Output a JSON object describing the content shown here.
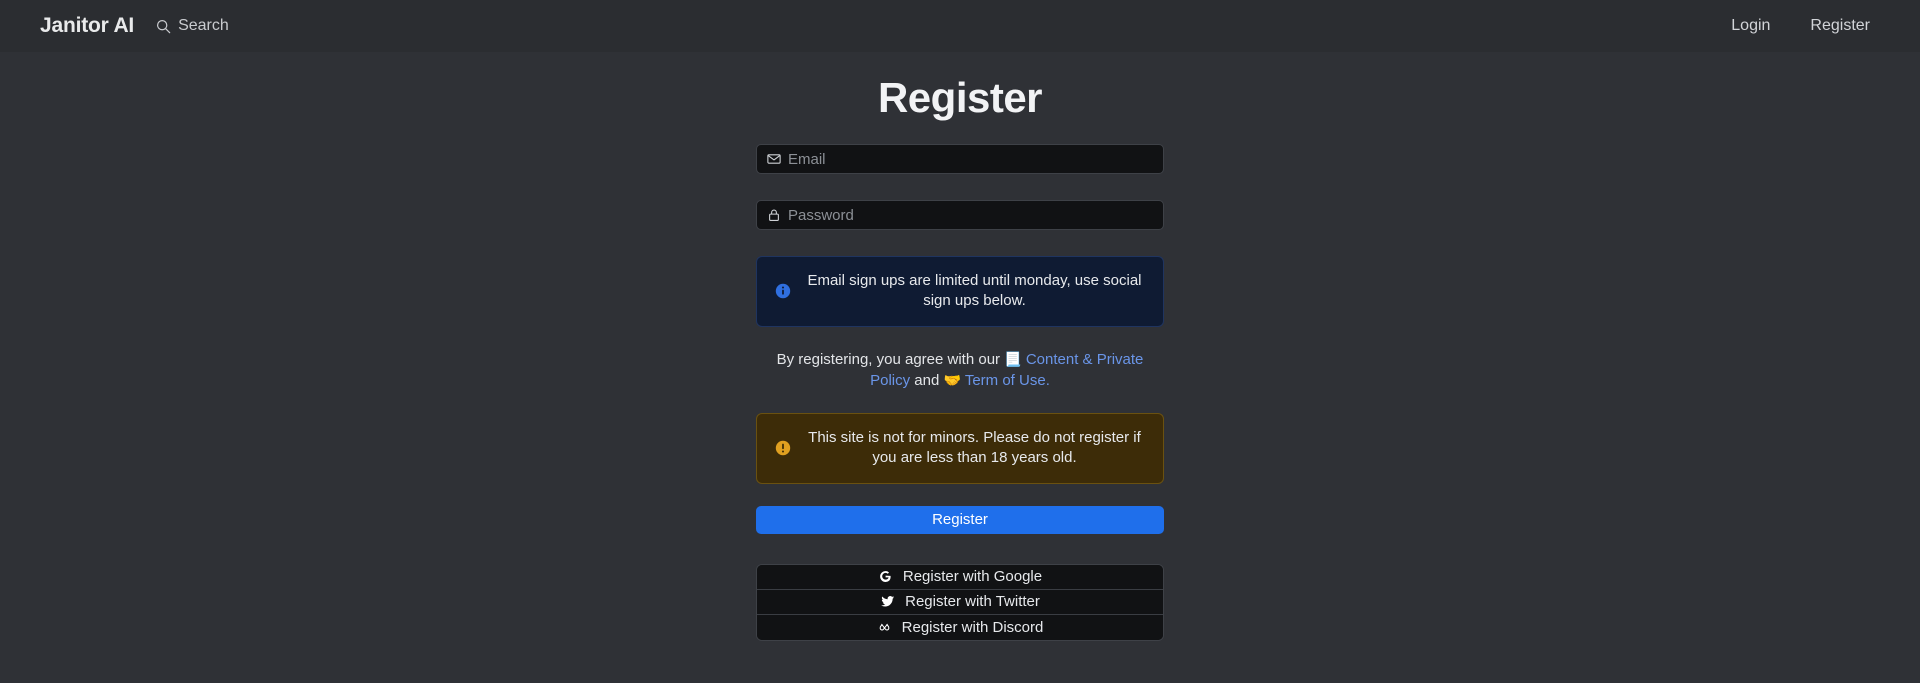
{
  "navbar": {
    "brand": "Janitor AI",
    "search_label": "Search",
    "search_icon": "search-icon",
    "links": [
      {
        "label": "Login",
        "name": "login"
      },
      {
        "label": "Register",
        "name": "register"
      }
    ]
  },
  "page": {
    "title": "Register"
  },
  "form": {
    "email": {
      "placeholder": "Email",
      "value": "",
      "icon": "envelope-icon"
    },
    "password": {
      "placeholder": "Password",
      "value": "",
      "icon": "lock-icon"
    },
    "info_alert": {
      "icon": "info-circle-icon",
      "text": "Email sign ups are limited until monday, use social sign ups below."
    },
    "terms": {
      "prefix": "By registering, you agree with our",
      "policy_emoji": "📃",
      "policy_link": "Content & Private Policy",
      "conjunction": "and",
      "terms_emoji": "🤝",
      "terms_link": "Term of Use."
    },
    "warning_alert": {
      "icon": "warning-circle-icon",
      "text": "This site is not for minors. Please do not register if you are less than 18 years old."
    },
    "submit_label": "Register",
    "social_buttons": [
      {
        "label": "Register with Google",
        "icon": "google-icon",
        "name": "google"
      },
      {
        "label": "Register with Twitter",
        "icon": "twitter-icon",
        "name": "twitter"
      },
      {
        "label": "Register with Discord",
        "icon": "discord-icon",
        "name": "discord"
      }
    ]
  },
  "colors": {
    "page_background": "#2f3136",
    "navbar_background": "#2b2d31",
    "input_background": "#111214",
    "accent_primary": "#1f6feb",
    "link": "#6a95e8",
    "info_background": "#0f1b33",
    "warning_background": "#3d2c08",
    "warning_icon": "#e0a020"
  }
}
